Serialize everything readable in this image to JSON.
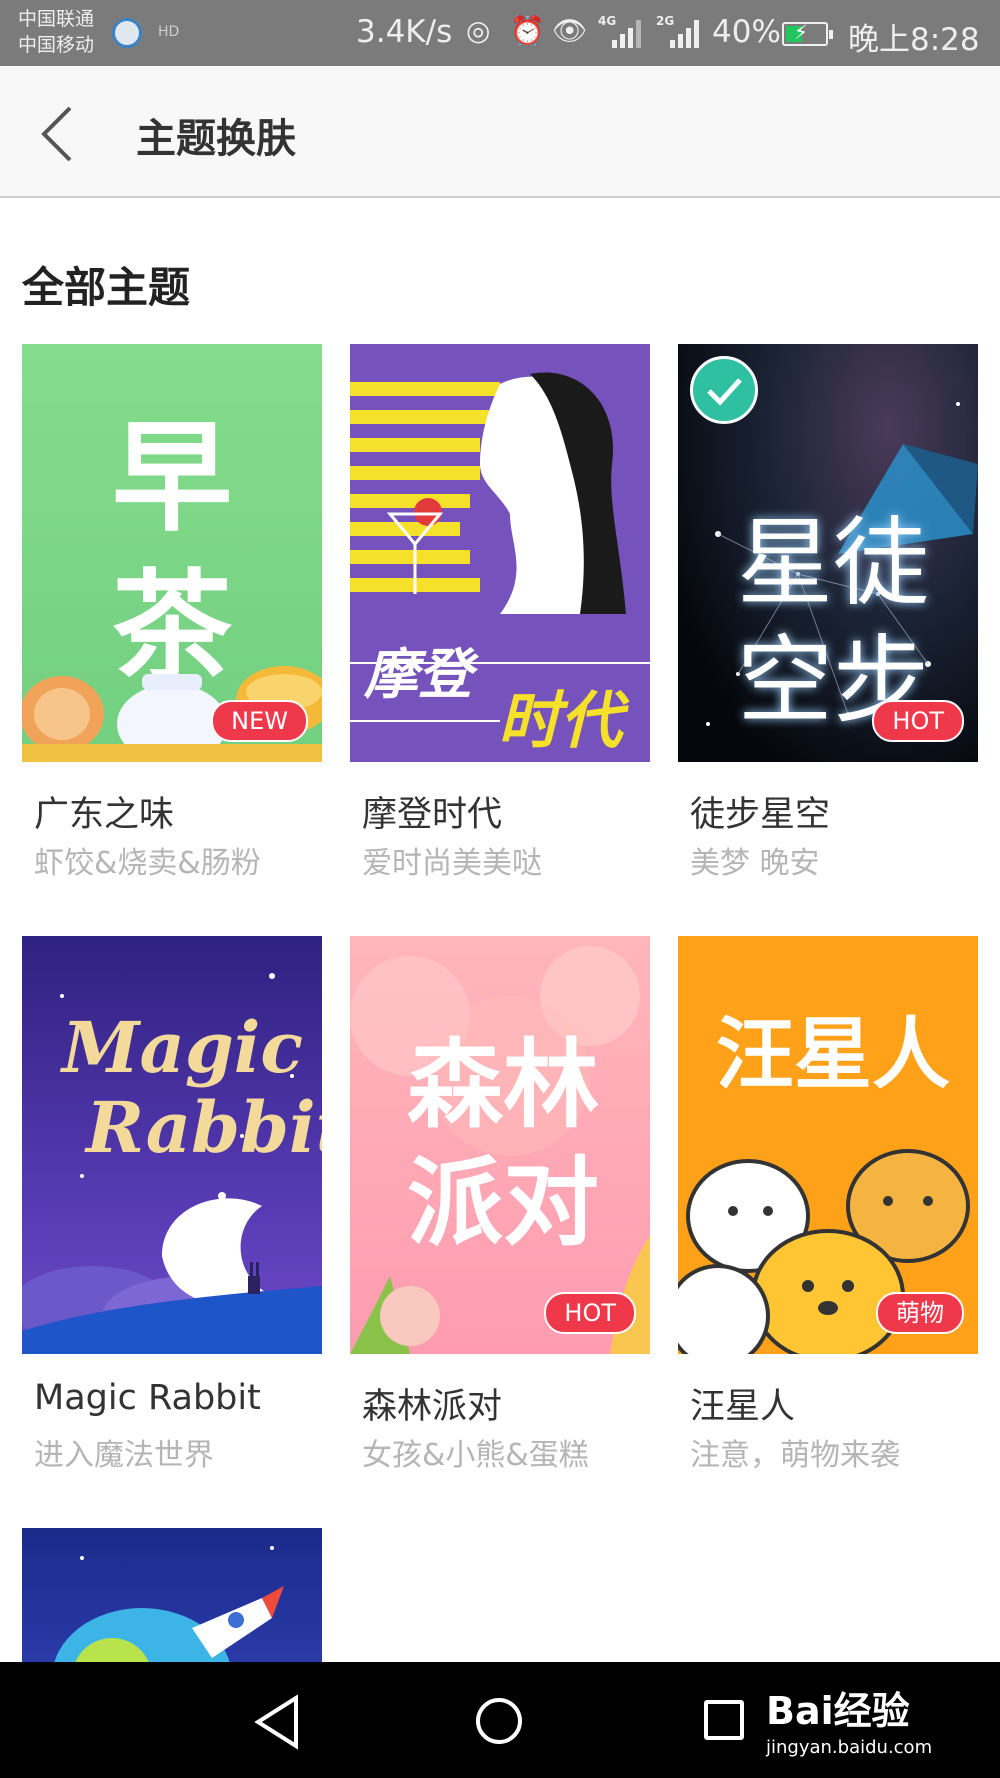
{
  "status_bar": {
    "carrier1": "中国联通",
    "carrier2": "中国移动",
    "hd": "HD",
    "speed": "3.4K/s",
    "net1": "4G",
    "net2": "2G",
    "battery": "40%",
    "time": "晚上8:28",
    "icons": [
      "hotspot-icon",
      "alarm-icon",
      "eye-comfort-icon",
      "signal-icon",
      "battery-charging-icon"
    ]
  },
  "header": {
    "title": "主题换肤"
  },
  "section_title": "全部主题",
  "themes": [
    {
      "art_chars": "早\n茶",
      "name": "广东之味",
      "sub": "虾饺&烧卖&肠粉",
      "badge": "NEW",
      "colors": [
        "#7fd98a",
        "#6fcf7e"
      ]
    },
    {
      "art_text1": "摩登",
      "art_text2": "时代",
      "name": "摩登时代",
      "sub": "爱时尚美美哒",
      "colors": [
        "#7b52bd",
        "#6a43ac"
      ]
    },
    {
      "art_chars": "星徒\n空步",
      "name": "徒步星空",
      "sub": "美梦 晚安",
      "badge": "HOT",
      "selected": true,
      "colors": [
        "#0b0f1a",
        "#1c2740"
      ]
    },
    {
      "art_text1": "Magic",
      "art_text2": "Rabbit",
      "name": "Magic Rabbit",
      "sub": "进入魔法世界",
      "colors": [
        "#3a2a8a",
        "#5a3bb0"
      ]
    },
    {
      "art_chars": "森林\n派对",
      "name": "森林派对",
      "sub": "女孩&小熊&蛋糕",
      "badge": "HOT",
      "colors": [
        "#ffb3b8",
        "#ff8fa3"
      ]
    },
    {
      "art_chars": "汪星人",
      "name": "汪星人",
      "sub": "注意，萌物来袭",
      "badge": "萌物",
      "colors": [
        "#ffa31a",
        "#ff9800"
      ]
    }
  ],
  "watermark": {
    "brand": "Bai经验",
    "url": "jingyan.baidu.com"
  }
}
